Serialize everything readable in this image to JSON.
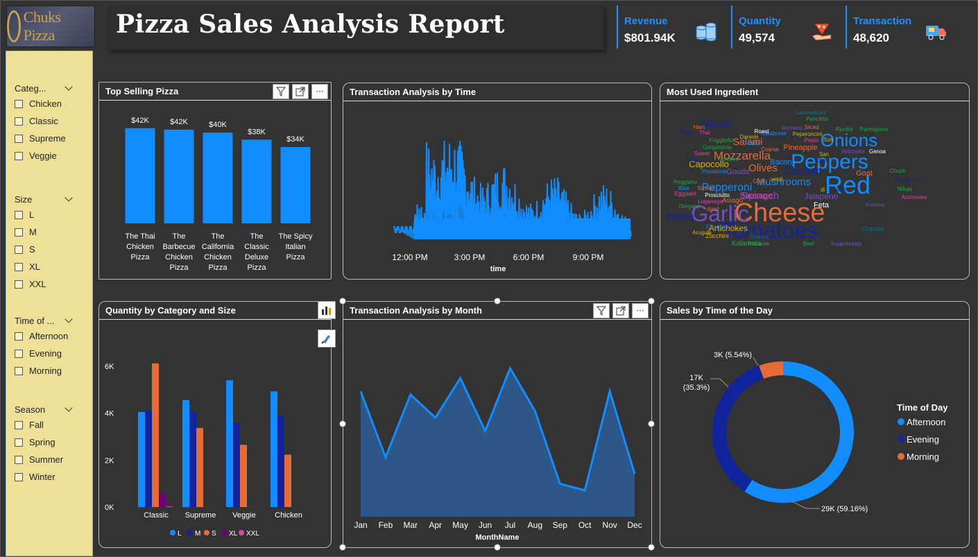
{
  "header": {
    "logo_text": "Chuks Pizza",
    "title": "Pizza Sales Analysis Report"
  },
  "kpis": [
    {
      "label": "Revenue",
      "value": "$801.94K",
      "icon": "coins-icon"
    },
    {
      "label": "Quantity",
      "value": "49,574",
      "icon": "pizza-hand-icon"
    },
    {
      "label": "Transaction",
      "value": "48,620",
      "icon": "delivery-truck-icon"
    }
  ],
  "filters": [
    {
      "title": "Categ...",
      "options": [
        "Chicken",
        "Classic",
        "Supreme",
        "Veggie"
      ]
    },
    {
      "title": "Size",
      "options": [
        "L",
        "M",
        "S",
        "XL",
        "XXL"
      ]
    },
    {
      "title": "Time of ...",
      "options": [
        "Afternoon",
        "Evening",
        "Morning"
      ]
    },
    {
      "title": "Season",
      "options": [
        "Fall",
        "Spring",
        "Summer",
        "Winter"
      ]
    }
  ],
  "panels": {
    "top_selling": "Top Selling Pizza",
    "time": "Transaction Analysis by Time",
    "ingredient": "Most Used Ingredient",
    "category_size": "Quantity by Category and Size",
    "month": "Transaction Analysis by Month",
    "time_of_day": "Sales by Time of the Day"
  },
  "colors": {
    "blue": "#118dff",
    "dark_blue": "#12239e",
    "orange": "#e66c37",
    "purple": "#6b007b",
    "pink": "#e044a7",
    "accent": "#1e90ff"
  },
  "chart_data": [
    {
      "type": "bar",
      "title": "Top Selling Pizza",
      "categories": [
        "The Thai Chicken Pizza",
        "The Barbecue Chicken Pizza",
        "The California Chicken Pizza",
        "The Classic Deluxe Pizza",
        "The Spicy Italian Pizza"
      ],
      "category_lines": [
        [
          "The Thai",
          "Chicken",
          "Pizza"
        ],
        [
          "The",
          "Barbecue",
          "Chicken",
          "Pizza"
        ],
        [
          "The",
          "California",
          "Chicken",
          "Pizza"
        ],
        [
          "The",
          "Classic",
          "Deluxe",
          "Pizza"
        ],
        [
          "The Spicy",
          "Italian",
          "Pizza"
        ]
      ],
      "values": [
        43434,
        42768,
        41410,
        38180,
        34831
      ],
      "data_labels": [
        "$42K",
        "$42K",
        "$40K",
        "$38K",
        "$34K"
      ]
    },
    {
      "type": "bar",
      "title": "Transaction Analysis by Time",
      "xlabel": "time",
      "x_ticks": [
        "12:00 PM",
        "3:00 PM",
        "6:00 PM",
        "9:00 PM"
      ]
    },
    {
      "type": "bar",
      "title": "Quantity by Category and Size",
      "categories": [
        "Classic",
        "Supreme",
        "Veggie",
        "Chicken"
      ],
      "y_ticks": [
        "0K",
        "2K",
        "4K",
        "6K"
      ],
      "ylim": [
        0,
        6500
      ],
      "series": [
        {
          "name": "L",
          "values": [
            4050,
            4560,
            5400,
            4930
          ]
        },
        {
          "name": "M",
          "values": [
            4100,
            4050,
            3580,
            3880
          ]
        },
        {
          "name": "S",
          "values": [
            6120,
            3370,
            2650,
            2230
          ]
        },
        {
          "name": "XL",
          "values": [
            560,
            0,
            0,
            0
          ]
        },
        {
          "name": "XXL",
          "values": [
            28,
            0,
            0,
            0
          ]
        }
      ]
    },
    {
      "type": "area",
      "title": "Transaction Analysis by Month",
      "xlabel": "MonthName",
      "categories": [
        "Jan",
        "Feb",
        "Mar",
        "Apr",
        "May",
        "Jun",
        "Jul",
        "Aug",
        "Sep",
        "Oct",
        "Nov",
        "Dec"
      ],
      "values": [
        4230,
        4030,
        4220,
        4150,
        4270,
        4110,
        4300,
        4170,
        3950,
        3930,
        4230,
        3980
      ],
      "ylim": [
        3850,
        4350
      ]
    },
    {
      "type": "pie",
      "title": "Sales by Time of the Day",
      "legend_title": "Time of Day",
      "slices": [
        {
          "name": "Afternoon",
          "value": 59.16,
          "label_top": "29K (59.16%)"
        },
        {
          "name": "Evening",
          "value": 35.3,
          "label_top": "17K",
          "label_bottom": "(35.3%)"
        },
        {
          "name": "Morning",
          "value": 5.54,
          "label_top": "3K (5.54%)"
        }
      ]
    },
    {
      "type": "table",
      "title": "Most Used Ingredient",
      "words": [
        {
          "t": "Cheese",
          "s": 38,
          "c": "#e66c37"
        },
        {
          "t": "Garlic",
          "s": 32,
          "c": "#744ec2"
        },
        {
          "t": "Tomatoes",
          "s": 32,
          "c": "#12239e"
        },
        {
          "t": "Red",
          "s": 36,
          "c": "#118dff"
        },
        {
          "t": "Peppers",
          "s": 30,
          "c": "#118dff"
        },
        {
          "t": "Onions",
          "s": 26,
          "c": "#118dff"
        },
        {
          "t": "Mozzarella",
          "s": 17,
          "c": "#e66c37"
        },
        {
          "t": "Pepperoni",
          "s": 16,
          "c": "#118dff"
        },
        {
          "t": "Mushrooms",
          "s": 15,
          "c": "#118dff"
        },
        {
          "t": "Spinach",
          "s": 15,
          "c": "#744ec2"
        },
        {
          "t": "Olives",
          "s": 15,
          "c": "#e66c37"
        },
        {
          "t": "Chicken",
          "s": 15,
          "c": "#12239e"
        },
        {
          "t": "Salami",
          "s": 14,
          "c": "#e66c37"
        },
        {
          "t": "Sauce",
          "s": 15,
          "c": "#12239e"
        },
        {
          "t": "Capocollo",
          "s": 13,
          "c": "#d9b300"
        },
        {
          "t": "Jalapeno",
          "s": 12,
          "c": "#744ec2"
        },
        {
          "t": "Artichokes",
          "s": 12,
          "c": "#d9b300"
        },
        {
          "t": "Green",
          "s": 14,
          "c": "#12239e"
        },
        {
          "t": "Sausage",
          "s": 12,
          "c": "#e044a7"
        },
        {
          "t": "Bacon",
          "s": 11,
          "c": "#118dff"
        },
        {
          "t": "Feta",
          "s": 11,
          "c": "#ffffff"
        },
        {
          "t": "Goat",
          "s": 11,
          "c": "#e66c37"
        },
        {
          "t": "Kalamata",
          "s": 10,
          "c": "#1aab40"
        },
        {
          "t": "Pineapple",
          "s": 11,
          "c": "#e66c37"
        },
        {
          "t": "Asiago",
          "s": 10,
          "c": "#e66c37"
        },
        {
          "t": "Gouda",
          "s": 11,
          "c": "#744ec2"
        },
        {
          "t": "Zucchini",
          "s": 9,
          "c": "#d9b300"
        },
        {
          "t": "Chipotle",
          "s": 9,
          "c": "#197278"
        },
        {
          "t": "Ricotta",
          "s": 8,
          "c": "#1aab40"
        },
        {
          "t": "Parmigiano",
          "s": 8,
          "c": "#1aab40"
        },
        {
          "t": "Pancetta",
          "s": 8,
          "c": "#1aab40"
        },
        {
          "t": "Caramelized",
          "s": 8,
          "c": "#197278"
        },
        {
          "t": "Sliced",
          "s": 8,
          "c": "#e66c37"
        },
        {
          "t": "Romano",
          "s": 8,
          "c": "#744ec2"
        },
        {
          "t": "Calabrese",
          "s": 8,
          "c": "#118dff"
        },
        {
          "t": "Peperoncini",
          "s": 8,
          "c": "#d9b300"
        },
        {
          "t": "Roast",
          "s": 8,
          "c": "#ffffff"
        },
        {
          "t": "Daniele",
          "s": 8,
          "c": "#d9b300"
        },
        {
          "t": "Pesto",
          "s": 8,
          "c": "#e044a7"
        },
        {
          "t": "Sun",
          "s": 8,
          "c": "#d9b300"
        },
        {
          "t": "Ham",
          "s": 8,
          "c": "#e66c37"
        },
        {
          "t": "Thai",
          "s": 8,
          "c": "#e044a7"
        },
        {
          "t": "Pearl",
          "s": 8,
          "c": "#12239e"
        },
        {
          "t": "Friggitello",
          "s": 8,
          "c": "#1aab40"
        },
        {
          "t": "Italian",
          "s": 8,
          "c": "#118dff"
        },
        {
          "t": "Coarse",
          "s": 8,
          "c": "#e66c37"
        },
        {
          "t": "Gorgonzola",
          "s": 8,
          "c": "#1aab40"
        },
        {
          "t": "Artichoke",
          "s": 8,
          "c": "#744ec2"
        },
        {
          "t": "Genoa",
          "s": 8,
          "c": "#ffffff"
        },
        {
          "t": "Sweet",
          "s": 8,
          "c": "#e044a7"
        },
        {
          "t": "Smoked",
          "s": 8,
          "c": "#1aab40"
        },
        {
          "t": "Thyme",
          "s": 8,
          "c": "#12239e"
        },
        {
          "t": "Corn",
          "s": 8,
          "c": "#12239e"
        },
        {
          "t": "San",
          "s": 8,
          "c": "#d9b300"
        },
        {
          "t": "Provolone",
          "s": 8,
          "c": "#118dff"
        },
        {
          "t": "Chuck",
          "s": 8,
          "c": "#1aab40"
        },
        {
          "t": "Reggiano",
          "s": 8,
          "c": "#1aab40"
        },
        {
          "t": "Chilli",
          "s": 8,
          "c": "#e66c37"
        },
        {
          "t": "verdi",
          "s": 8,
          "c": "#d9b300"
        },
        {
          "t": "Barbecued",
          "s": 8,
          "c": "#12239e"
        },
        {
          "t": "Blue",
          "s": 8,
          "c": "#118dff"
        },
        {
          "t": "Sicilian",
          "s": 8,
          "c": "#e66c37"
        },
        {
          "t": "di",
          "s": 8,
          "c": "#d9b300"
        },
        {
          "t": "Carre",
          "s": 8,
          "c": "#12239e"
        },
        {
          "t": "Nduja",
          "s": 8,
          "c": "#1aab40"
        },
        {
          "t": "Eggplant",
          "s": 8,
          "c": "#e044a7"
        },
        {
          "t": "Prosciutto",
          "s": 8,
          "c": "#ffffff"
        },
        {
          "t": "Anchovies",
          "s": 8,
          "c": "#e044a7"
        },
        {
          "t": "Luganega",
          "s": 8,
          "c": "#e044a7"
        },
        {
          "t": "Fontina",
          "s": 8,
          "c": "#744ec2"
        },
        {
          "t": "Oregano",
          "s": 8,
          "c": "#1aab40"
        },
        {
          "t": "dried",
          "s": 8,
          "c": "#e66c37"
        },
        {
          "t": "Chorizo",
          "s": 8,
          "c": "#118dff"
        },
        {
          "t": "Arugula",
          "s": 8,
          "c": "#d9b300"
        },
        {
          "t": "Cilantro",
          "s": 8,
          "c": "#197278"
        },
        {
          "t": "Piccante",
          "s": 8,
          "c": "#1aab40"
        },
        {
          "t": "Beef",
          "s": 8,
          "c": "#1aab40"
        },
        {
          "t": "Soppressata",
          "s": 8,
          "c": "#744ec2"
        }
      ]
    }
  ]
}
